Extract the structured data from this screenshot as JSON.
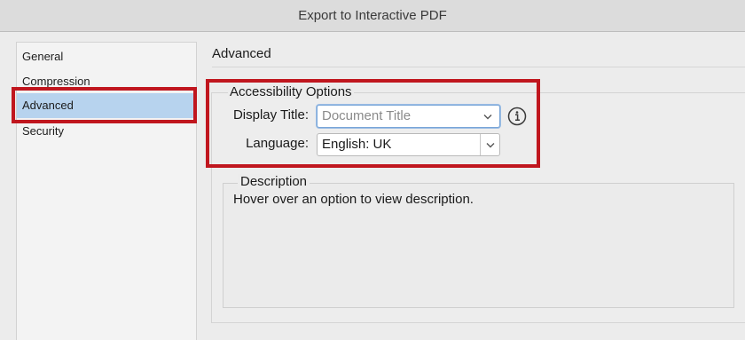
{
  "window": {
    "title": "Export to Interactive PDF"
  },
  "sidebar": {
    "items": [
      {
        "label": "General"
      },
      {
        "label": "Compression"
      },
      {
        "label": "Advanced",
        "selected": true
      },
      {
        "label": "Security"
      }
    ]
  },
  "main": {
    "heading": "Advanced",
    "accessibility": {
      "group_title": "Accessibility Options",
      "display_title_label": "Display Title:",
      "display_title_value": "Document Title",
      "language_label": "Language:",
      "language_value": "English: UK",
      "info_icon": "info-circle-icon"
    },
    "description": {
      "title": "Description",
      "text": "Hover over an option to view description."
    }
  },
  "colors": {
    "highlight_box": "#c0161e",
    "selection": "#b7d3ee"
  }
}
